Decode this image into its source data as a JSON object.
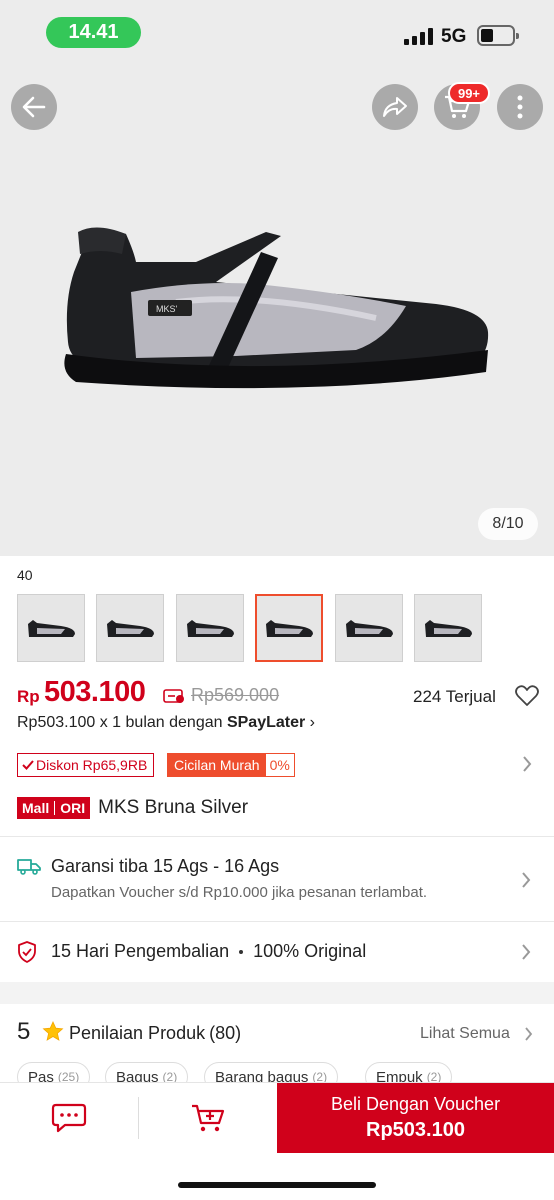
{
  "status_bar": {
    "time": "14.41",
    "network": "5G"
  },
  "header": {
    "cart_badge": "99+"
  },
  "image_counter": "8/10",
  "variant": {
    "label": "40"
  },
  "price": {
    "currency": "Rp",
    "value": "503.100",
    "original": "Rp569.000",
    "sold": "224 Terjual",
    "installment_prefix": "Rp503.100 x 1 bulan dengan ",
    "installment_brand": "SPayLater",
    "installment_chevron": "›"
  },
  "badges": {
    "discount": "Diskon Rp65,9RB",
    "installment_label": "Cicilan Murah",
    "installment_rate": "0%"
  },
  "product": {
    "mall_label": "Mall",
    "ori_label": "ORI",
    "title": "MKS Bruna Silver"
  },
  "shipping": {
    "title": "Garansi tiba 15 Ags - 16 Ags",
    "subtitle": "Dapatkan Voucher s/d Rp10.000 jika pesanan terlambat."
  },
  "returns": {
    "days": "15 Hari Pengembalian",
    "original": "100% Original"
  },
  "rating": {
    "score": "5",
    "label": "Penilaian Produk",
    "count": "(80)",
    "see_all": "Lihat Semua",
    "chips": [
      {
        "label": "Pas",
        "count": "(25)"
      },
      {
        "label": "Bagus",
        "count": "(2)"
      },
      {
        "label": "Barang bagus",
        "count": "(2)"
      },
      {
        "label": "Empuk",
        "count": "(2)"
      }
    ]
  },
  "bottom_bar": {
    "buy_label": "Beli Dengan Voucher",
    "buy_price": "Rp503.100"
  },
  "colors": {
    "brand_red": "#d0011b",
    "shopee_orange": "#ee4d2d",
    "status_green": "#34c759"
  }
}
